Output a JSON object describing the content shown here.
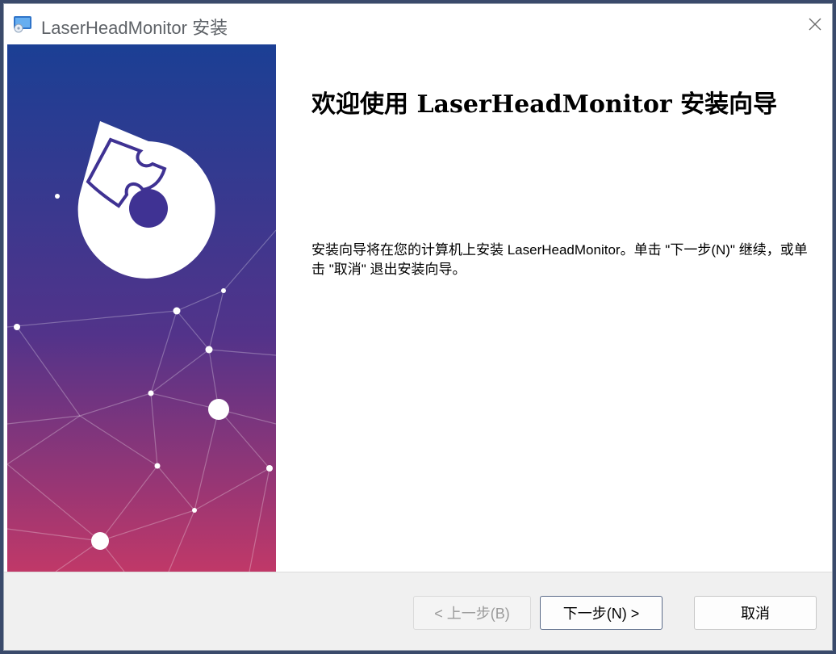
{
  "window": {
    "title": "LaserHeadMonitor 安装",
    "close_glyph": "✕",
    "icons": {
      "app": "installer-app-icon",
      "close": "close-icon",
      "logo": "puzzle-logo-icon"
    }
  },
  "banner": {
    "colors": {
      "top": "#1b3f94",
      "middle": "#52338a",
      "bottom": "#c03868"
    }
  },
  "main": {
    "heading": "欢迎使用 LaserHeadMonitor 安装向导",
    "description": "安装向导将在您的计算机上安装 LaserHeadMonitor。单击 \"下一步(N)\" 继续，或单击 \"取消\" 退出安装向导。"
  },
  "buttons": {
    "back": "< 上一步(B)",
    "next": "下一步(N) >",
    "cancel": "取消"
  }
}
